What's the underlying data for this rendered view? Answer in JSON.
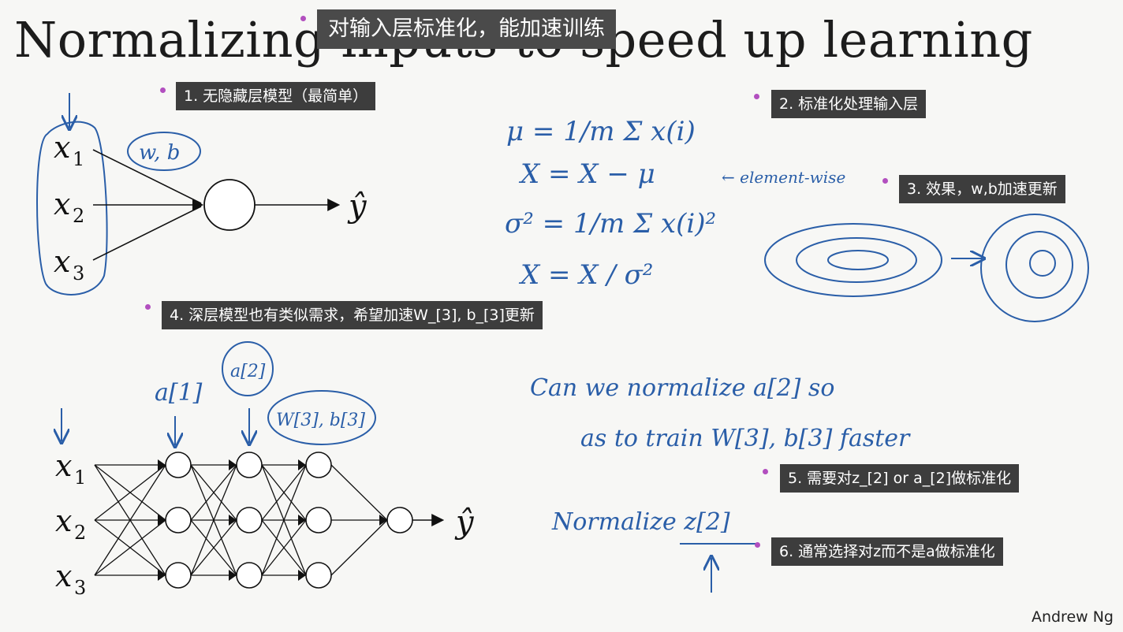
{
  "slide": {
    "title": "Normalizing inputs to speed up learning",
    "author": "Andrew Ng"
  },
  "captions": {
    "top": "对输入层标准化，能加速训练",
    "c1": "1. 无隐藏层模型（最简单）",
    "c2": "2. 标准化处理输入层",
    "c3": "3. 效果，w,b加速更新",
    "c4": "4. 深层模型也有类似需求，希望加速W_[3], b_[3]更新",
    "c5": "5. 需要对z_[2] or a_[2]做标准化",
    "c6": "6. 通常选择对z而不是a做标准化"
  },
  "network1": {
    "inputs": [
      "x",
      "x",
      "x"
    ],
    "subscripts": [
      "1",
      "2",
      "3"
    ],
    "params_note": "w, b",
    "output": "ŷ"
  },
  "network2": {
    "inputs": [
      "x",
      "x",
      "x"
    ],
    "subscripts": [
      "1",
      "2",
      "3"
    ],
    "output": "ŷ",
    "layer_notes": [
      "a[1]",
      "a[2]",
      "W[3], b[3]"
    ]
  },
  "handwriting": {
    "mean_formula": "μ = 1/m Σ x(i)",
    "subtract_mean": "X = X − μ",
    "variance_formula": "σ² = 1/m Σ x(i)²",
    "divide_variance": "X = X / σ²",
    "element_wise": "← element-wise",
    "question_line1": "Can we normalize a[2] so",
    "question_line2": "as to train W[3], b[3] faster",
    "normalize_z": "Normalize z[2]"
  },
  "colors": {
    "ink": "#2a5ea8",
    "caption_bg": "#3d3d3d",
    "marker": "#b24fbf"
  }
}
